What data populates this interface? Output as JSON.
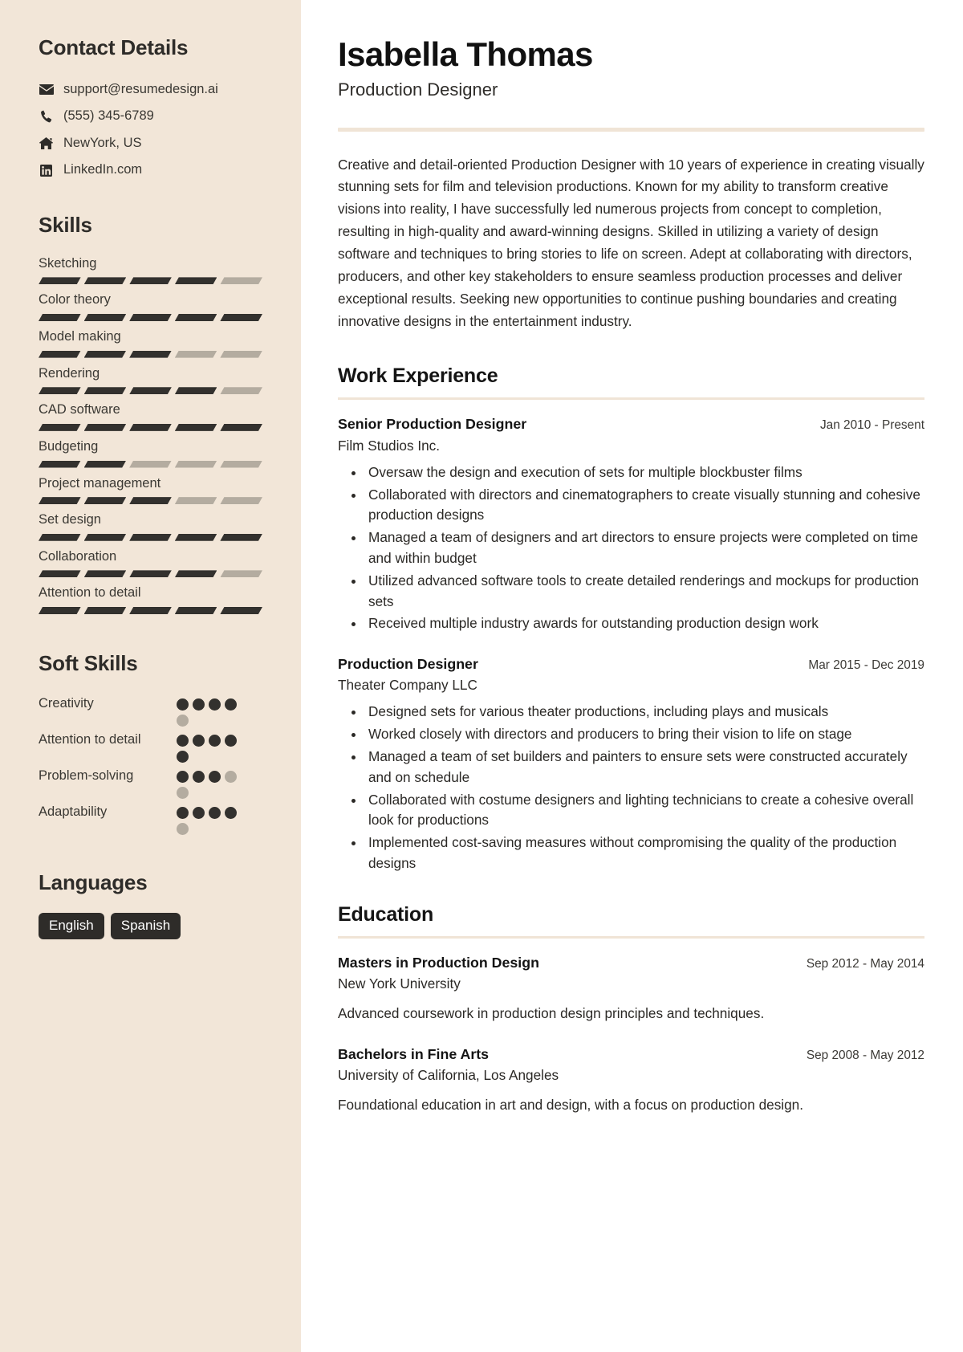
{
  "theme": {
    "sidebar_bg": "#f2e6d8",
    "accent_rule": "#f0e4d6",
    "ink": "#2e2c29",
    "bar_on": "#33312e",
    "bar_off": "#b4aca0"
  },
  "sidebar": {
    "contact": {
      "heading": "Contact Details",
      "items": [
        {
          "icon": "envelope-icon",
          "value": "support@resumedesign.ai"
        },
        {
          "icon": "phone-icon",
          "value": "(555) 345-6789"
        },
        {
          "icon": "home-icon",
          "value": "NewYork, US"
        },
        {
          "icon": "linkedin-icon",
          "value": "LinkedIn.com"
        }
      ]
    },
    "skills": {
      "heading": "Skills",
      "max": 5,
      "items": [
        {
          "name": "Sketching",
          "level": 4
        },
        {
          "name": "Color theory",
          "level": 5
        },
        {
          "name": "Model making",
          "level": 3
        },
        {
          "name": "Rendering",
          "level": 4
        },
        {
          "name": "CAD software",
          "level": 5
        },
        {
          "name": "Budgeting",
          "level": 2
        },
        {
          "name": "Project management",
          "level": 3
        },
        {
          "name": "Set design",
          "level": 5
        },
        {
          "name": "Collaboration",
          "level": 4
        },
        {
          "name": "Attention to detail",
          "level": 5
        }
      ]
    },
    "soft_skills": {
      "heading": "Soft Skills",
      "max": 5,
      "items": [
        {
          "name": "Creativity",
          "level": 4
        },
        {
          "name": "Attention to detail",
          "level": 5
        },
        {
          "name": "Problem-solving",
          "level": 3
        },
        {
          "name": "Adaptability",
          "level": 4
        }
      ]
    },
    "languages": {
      "heading": "Languages",
      "items": [
        "English",
        "Spanish"
      ]
    }
  },
  "header": {
    "name": "Isabella Thomas",
    "title": "Production Designer"
  },
  "summary": "Creative and detail-oriented Production Designer with 10 years of experience in creating visually stunning sets for film and television productions. Known for my ability to transform creative visions into reality, I have successfully led numerous projects from concept to completion, resulting in high-quality and award-winning designs. Skilled in utilizing a variety of design software and techniques to bring stories to life on screen. Adept at collaborating with directors, producers, and other key stakeholders to ensure seamless production processes and deliver exceptional results. Seeking new opportunities to continue pushing boundaries and creating innovative designs in the entertainment industry.",
  "work_experience": {
    "heading": "Work Experience",
    "entries": [
      {
        "role": "Senior Production Designer",
        "org": "Film Studios Inc.",
        "date": "Jan 2010 - Present",
        "bullets": [
          "Oversaw the design and execution of sets for multiple blockbuster films",
          "Collaborated with directors and cinematographers to create visually stunning and cohesive production designs",
          "Managed a team of designers and art directors to ensure projects were completed on time and within budget",
          "Utilized advanced software tools to create detailed renderings and mockups for production sets",
          "Received multiple industry awards for outstanding production design work"
        ]
      },
      {
        "role": "Production Designer",
        "org": "Theater Company LLC",
        "date": "Mar 2015 - Dec 2019",
        "bullets": [
          "Designed sets for various theater productions, including plays and musicals",
          "Worked closely with directors and producers to bring their vision to life on stage",
          "Managed a team of set builders and painters to ensure sets were constructed accurately and on schedule",
          "Collaborated with costume designers and lighting technicians to create a cohesive overall look for productions",
          "Implemented cost-saving measures without compromising the quality of the production designs"
        ]
      }
    ]
  },
  "education": {
    "heading": "Education",
    "entries": [
      {
        "degree": "Masters in Production Design",
        "school": "New York University",
        "date": "Sep 2012 - May 2014",
        "description": "Advanced coursework in production design principles and techniques."
      },
      {
        "degree": "Bachelors in Fine Arts",
        "school": "University of California, Los Angeles",
        "date": "Sep 2008 - May 2012",
        "description": "Foundational education in art and design, with a focus on production design."
      }
    ]
  }
}
